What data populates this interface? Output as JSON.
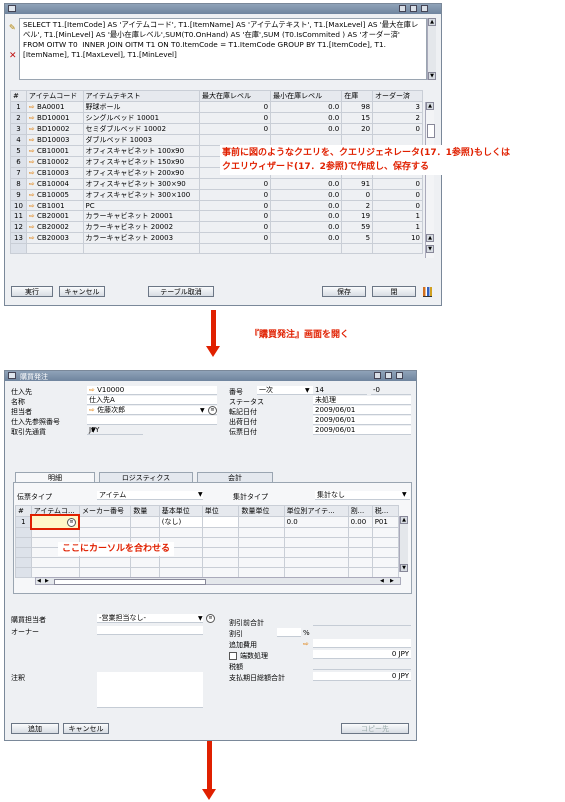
{
  "query_window": {
    "sql_text": "SELECT T1.[ItemCode] AS 'アイテムコード', T1.[ItemName] AS 'アイテムテキスト', T1.[MaxLevel] AS '最大在庫レベル', T1.[MinLevel] AS '最小在庫レベル',SUM(T0.OnHand) AS '在庫',SUM (T0.IsCommited ) AS 'オーダー済' FROM OITW T0  INNER JOIN OITM T1 ON T0.ItemCode = T1.ItemCode GROUP BY T1.[ItemCode], T1.[ItemName], T1.[MaxLevel], T1.[MinLevel]",
    "columns": [
      "#",
      "アイテムコード",
      "アイテムテキスト",
      "最大在庫レベル",
      "最小在庫レベル",
      "在庫",
      "オーダー済"
    ],
    "rows": [
      {
        "n": "1",
        "code": "BA0001",
        "name": "野球ボール",
        "max": "0",
        "min": "0.0",
        "stock": "98",
        "ordered": "3"
      },
      {
        "n": "2",
        "code": "BD10001",
        "name": "シングルベッド  10001",
        "max": "0",
        "min": "0.0",
        "stock": "15",
        "ordered": "2"
      },
      {
        "n": "3",
        "code": "BD10002",
        "name": "セミダブルベッド  10002",
        "max": "0",
        "min": "0.0",
        "stock": "20",
        "ordered": "0"
      },
      {
        "n": "4",
        "code": "BD10003",
        "name": "ダブルベッド  10003",
        "max": "",
        "min": "",
        "stock": "",
        "ordered": ""
      },
      {
        "n": "5",
        "code": "CB10001",
        "name": "オフィスキャビネット 100x90",
        "max": "",
        "min": "",
        "stock": "",
        "ordered": ""
      },
      {
        "n": "6",
        "code": "CB10002",
        "name": "オフィスキャビネット 150x90",
        "max": "",
        "min": "",
        "stock": "",
        "ordered": ""
      },
      {
        "n": "7",
        "code": "CB10003",
        "name": "オフィスキャビネット  200x90",
        "max": "",
        "min": "",
        "stock": "",
        "ordered": ""
      },
      {
        "n": "8",
        "code": "CB10004",
        "name": "オフィスキャビネット  300×90",
        "max": "0",
        "min": "0.0",
        "stock": "91",
        "ordered": "0"
      },
      {
        "n": "9",
        "code": "CB10005",
        "name": "オフィスキャビネット  300×100",
        "max": "0",
        "min": "0.0",
        "stock": "0",
        "ordered": "0"
      },
      {
        "n": "10",
        "code": "CB1001",
        "name": "PC",
        "max": "0",
        "min": "0.0",
        "stock": "2",
        "ordered": "0"
      },
      {
        "n": "11",
        "code": "CB20001",
        "name": "カラーキャビネット 20001",
        "max": "0",
        "min": "0.0",
        "stock": "19",
        "ordered": "1"
      },
      {
        "n": "12",
        "code": "CB20002",
        "name": "カラーキャビネット 20002",
        "max": "0",
        "min": "0.0",
        "stock": "59",
        "ordered": "1"
      },
      {
        "n": "13",
        "code": "CB20003",
        "name": "カラーキャビネット 20003",
        "max": "0",
        "min": "0.0",
        "stock": "5",
        "ordered": "10"
      }
    ],
    "buttons": {
      "execute": "実行",
      "cancel": "キャンセル",
      "table_cancel": "テーブル取消",
      "save": "保存",
      "close": "閉"
    }
  },
  "callout_query": {
    "line1": "事前に図のようなクエリを、クエリジェネレータ(17．1参照)もしくは",
    "line2": "クエリウィザード(17．2参照)で作成し、保存する"
  },
  "step_label": "『購買発注』画面を開く",
  "po_window": {
    "title": "購買発注",
    "header_left": [
      {
        "label": "仕入先",
        "value": "V10000",
        "link": true
      },
      {
        "label": "名称",
        "value": "仕入先A",
        "link": false
      },
      {
        "label": "担当者",
        "value": "佐藤次郎",
        "link": true
      },
      {
        "label": "仕入先参照番号",
        "value": "",
        "link": false
      },
      {
        "label": "取引先通貨",
        "value": "JPY",
        "link": false
      }
    ],
    "header_right": [
      {
        "label": "番号",
        "value": "一次",
        "value2": "14",
        "value3": "-0"
      },
      {
        "label": "ステータス",
        "value": "未処理"
      },
      {
        "label": "転記日付",
        "value": "2009/06/01"
      },
      {
        "label": "出荷日付",
        "value": "2009/06/01"
      },
      {
        "label": "伝票日付",
        "value": "2009/06/01"
      }
    ],
    "tabs": [
      "明細",
      "ロジスティクス",
      "会計"
    ],
    "doc_type_label": "伝票タイプ",
    "doc_type_value": "アイテム",
    "summary_type_label": "集計タイプ",
    "summary_type_value": "集計なし",
    "grid_columns": [
      "#",
      "アイテムコ...",
      "メーカー番号",
      "数量",
      "基本単位",
      "単位",
      "数量単位",
      "単位別アイテ...",
      "割...",
      "税..."
    ],
    "grid_row1": {
      "n": "1",
      "unit": "(なし)",
      "qty_per_unit": "0.0",
      "discount": "0.00",
      "tax": "P01"
    },
    "footer_left": [
      {
        "label": "購買担当者",
        "value": "-営業担当なし-"
      },
      {
        "label": "オーナー",
        "value": ""
      },
      {
        "label": "注釈",
        "value": ""
      }
    ],
    "footer_right": [
      {
        "label": "割引前合計",
        "value": ""
      },
      {
        "label": "割引",
        "value": "",
        "unit": "%"
      },
      {
        "label": "追加費用",
        "value": ""
      },
      {
        "label": "端数処理",
        "value": "0 JPY",
        "checkbox": true
      },
      {
        "label": "税額",
        "value": ""
      },
      {
        "label": "支払期日総額合計",
        "value": "0 JPY"
      }
    ],
    "buttons": {
      "add": "追加",
      "cancel": "キャンセル",
      "copy_to": "コピー先"
    }
  },
  "callout_cursor": "ここにカーソルを合わせる",
  "colors": {
    "accent_red": "#e02000",
    "link_orange": "#e07a00",
    "title_blue": "#7388a2"
  }
}
